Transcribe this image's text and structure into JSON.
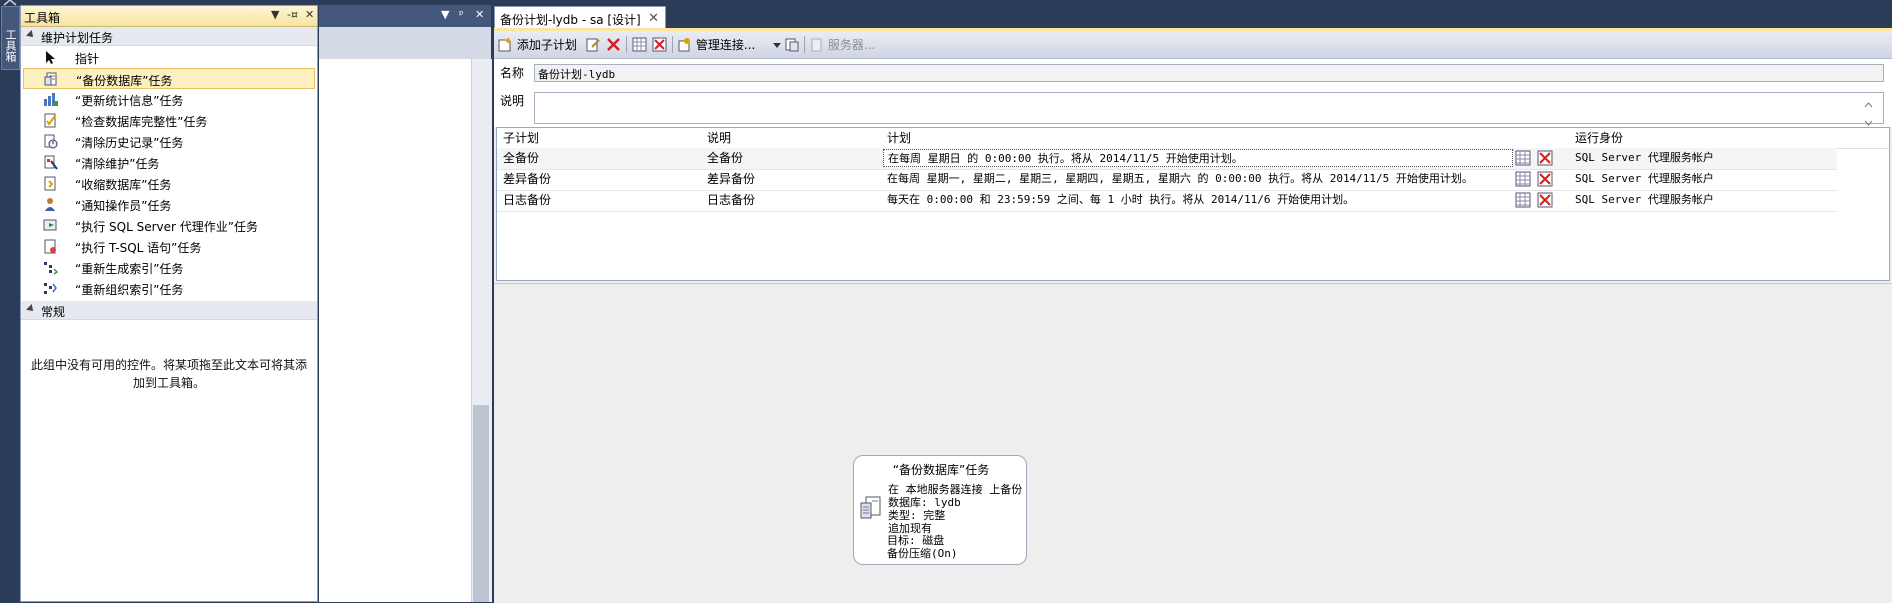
{
  "side_strip": {
    "tab_label": "工具箱"
  },
  "toolbox": {
    "title": "工具箱",
    "controls": {
      "dropdown": "▼",
      "pin": "-¤",
      "close": "✕"
    },
    "groups": [
      {
        "name": "维护计划任务",
        "items": [
          {
            "label": "指针",
            "icon": "pointer-icon"
          },
          {
            "label": "“备份数据库”任务",
            "icon": "backup-db-icon",
            "selected": true
          },
          {
            "label": "“更新统计信息”任务",
            "icon": "update-stats-icon"
          },
          {
            "label": "“检查数据库完整性”任务",
            "icon": "check-integrity-icon"
          },
          {
            "label": "“清除历史记录”任务",
            "icon": "clean-history-icon"
          },
          {
            "label": "“清除维护”任务",
            "icon": "cleanup-maint-icon"
          },
          {
            "label": "“收缩数据库”任务",
            "icon": "shrink-db-icon"
          },
          {
            "label": "“通知操作员”任务",
            "icon": "notify-operator-icon"
          },
          {
            "label": "“执行 SQL Server 代理作业”任务",
            "icon": "run-agent-job-icon"
          },
          {
            "label": "“执行 T-SQL 语句”任务",
            "icon": "run-tsql-icon"
          },
          {
            "label": "“重新生成索引”任务",
            "icon": "rebuild-index-icon"
          },
          {
            "label": "“重新组织索引”任务",
            "icon": "reorganize-index-icon"
          }
        ]
      },
      {
        "name": "常规",
        "items": []
      }
    ],
    "empty_message": "此组中没有可用的控件。将某项拖至此文本可将其添加到工具箱。"
  },
  "panel2": {
    "controls": {
      "dropdown": "▼",
      "pin": "ᵖ",
      "close": "✕"
    }
  },
  "document": {
    "tab_title": "备份计划-lydb - sa [设计]",
    "tab_close": "✕",
    "toolbar": {
      "add_subplan": "添加子计划",
      "manage_connections": "管理连接...",
      "servers": "服务器..."
    },
    "name_label": "名称",
    "name_value": "备份计划-lydb",
    "desc_label": "说明",
    "grid": {
      "headers": [
        "子计划",
        "说明",
        "计划",
        "运行身份"
      ],
      "rows": [
        {
          "subplan": "全备份",
          "desc": "全备份",
          "schedule": "在每周 星期日 的 0:00:00 执行。将从 2014/11/5 开始使用计划。",
          "run_as": "SQL Server 代理服务帐户"
        },
        {
          "subplan": "差异备份",
          "desc": "差异备份",
          "schedule": "在每周 星期一, 星期二, 星期三, 星期四, 星期五, 星期六 的 0:00:00 执行。将从 2014/11/5 开始使用计划。",
          "run_as": "SQL Server 代理服务帐户"
        },
        {
          "subplan": "日志备份",
          "desc": "日志备份",
          "schedule": "每天在 0:00:00 和 23:59:59 之间、每 1 小时 执行。将从 2014/11/6 开始使用计划。",
          "run_as": "SQL Server 代理服务帐户"
        }
      ]
    },
    "task_box": {
      "title": "“备份数据库”任务",
      "lines": [
        "在 本地服务器连接 上备份",
        "数据库: lydb",
        "类型: 完整",
        "追加现有",
        "目标: 磁盘",
        "备份压缩(On)"
      ]
    }
  }
}
